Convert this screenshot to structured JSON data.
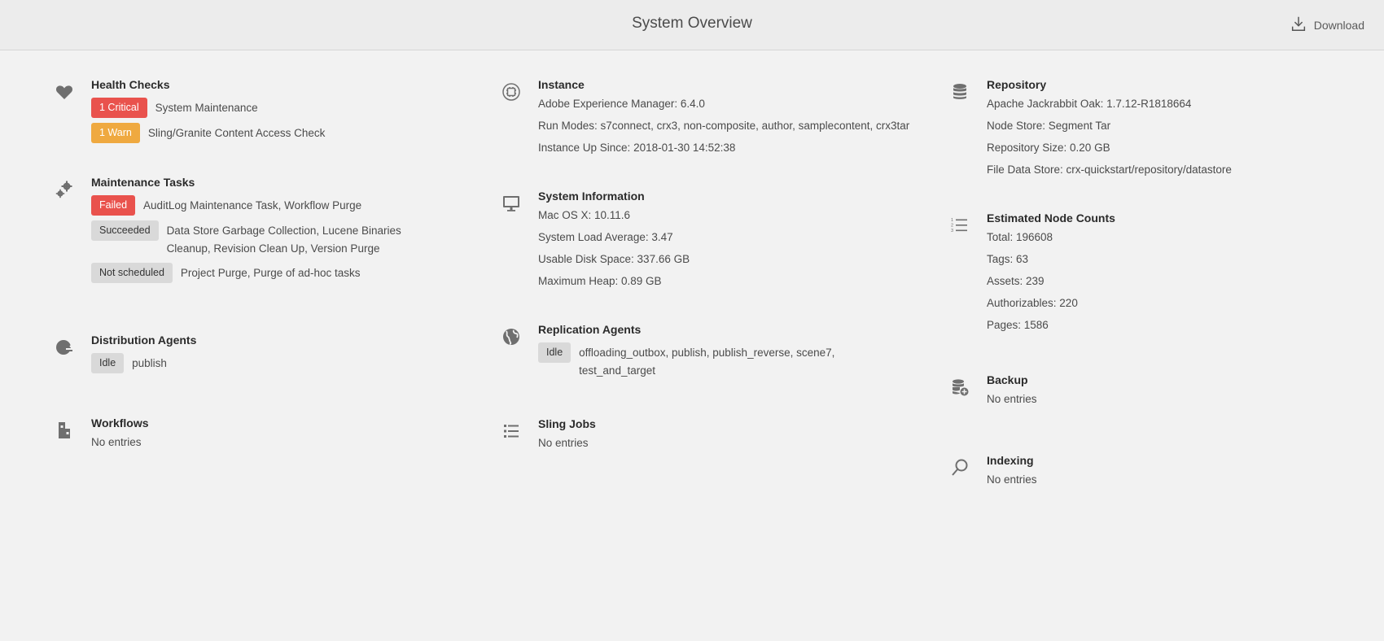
{
  "header": {
    "title": "System Overview",
    "download_label": "Download"
  },
  "health": {
    "title": "Health Checks",
    "items": [
      {
        "badge": "1 Critical",
        "text": "System Maintenance",
        "status_color": "#e9524d"
      },
      {
        "badge": "1 Warn",
        "text": "Sling/Granite Content Access Check",
        "status_color": "#efa940"
      }
    ]
  },
  "maintenance": {
    "title": "Maintenance Tasks",
    "items": [
      {
        "badge": "Failed",
        "lines": [
          "AuditLog Maintenance Task, Workflow Purge"
        ]
      },
      {
        "badge": "Succeeded",
        "lines": [
          "Data Store Garbage Collection, Lucene Binaries",
          "Cleanup, Revision Clean Up, Version Purge"
        ]
      },
      {
        "badge": "Not scheduled",
        "lines": [
          "Project Purge, Purge of ad-hoc tasks"
        ]
      }
    ]
  },
  "distribution": {
    "title": "Distribution Agents",
    "badge": "Idle",
    "text": "publish"
  },
  "workflows": {
    "title": "Workflows",
    "text": "No entries"
  },
  "instance": {
    "title": "Instance",
    "lines": [
      "Adobe Experience Manager: 6.4.0",
      "Run Modes: s7connect, crx3, non-composite, author, samplecontent, crx3tar",
      "Instance Up Since: 2018-01-30 14:52:38"
    ]
  },
  "system": {
    "title": "System Information",
    "lines": [
      "Mac OS X: 10.11.6",
      "System Load Average: 3.47",
      "Usable Disk Space: 337.66 GB",
      "Maximum Heap: 0.89 GB"
    ]
  },
  "replication": {
    "title": "Replication Agents",
    "badge": "Idle",
    "lines": [
      "offloading_outbox, publish, publish_reverse, scene7,",
      "test_and_target"
    ]
  },
  "sling": {
    "title": "Sling Jobs",
    "text": "No entries"
  },
  "repository": {
    "title": "Repository",
    "lines": [
      "Apache Jackrabbit Oak: 1.7.12-R1818664",
      "Node Store: Segment Tar",
      "Repository Size: 0.20 GB",
      "File Data Store: crx-quickstart/repository/datastore"
    ]
  },
  "nodecounts": {
    "title": "Estimated Node Counts",
    "lines": [
      "Total: 196608",
      "Tags: 63",
      "Assets: 239",
      "Authorizables: 220",
      "Pages: 1586"
    ]
  },
  "backup": {
    "title": "Backup",
    "text": "No entries"
  },
  "indexing": {
    "title": "Indexing",
    "text": "No entries"
  }
}
